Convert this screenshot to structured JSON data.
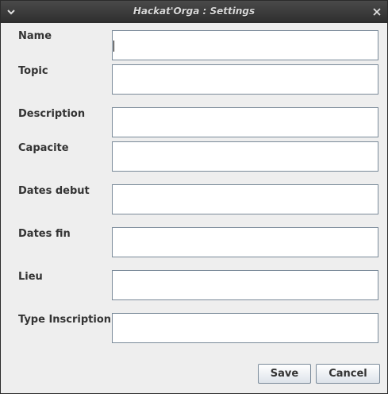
{
  "window": {
    "title": "Hackat'Orga : Settings"
  },
  "icons": {
    "menu": "chevron-down-icon",
    "close": "close-icon"
  },
  "form": {
    "fields": [
      {
        "label": "Name",
        "value": ""
      },
      {
        "label": "Topic",
        "value": ""
      },
      {
        "label": "Description",
        "value": ""
      },
      {
        "label": "Capacite",
        "value": ""
      },
      {
        "label": "Dates debut",
        "value": ""
      },
      {
        "label": "Dates fin",
        "value": ""
      },
      {
        "label": "Lieu",
        "value": ""
      },
      {
        "label": "Type Inscription",
        "value": ""
      }
    ]
  },
  "buttons": {
    "save_label": "Save",
    "cancel_label": "Cancel"
  }
}
